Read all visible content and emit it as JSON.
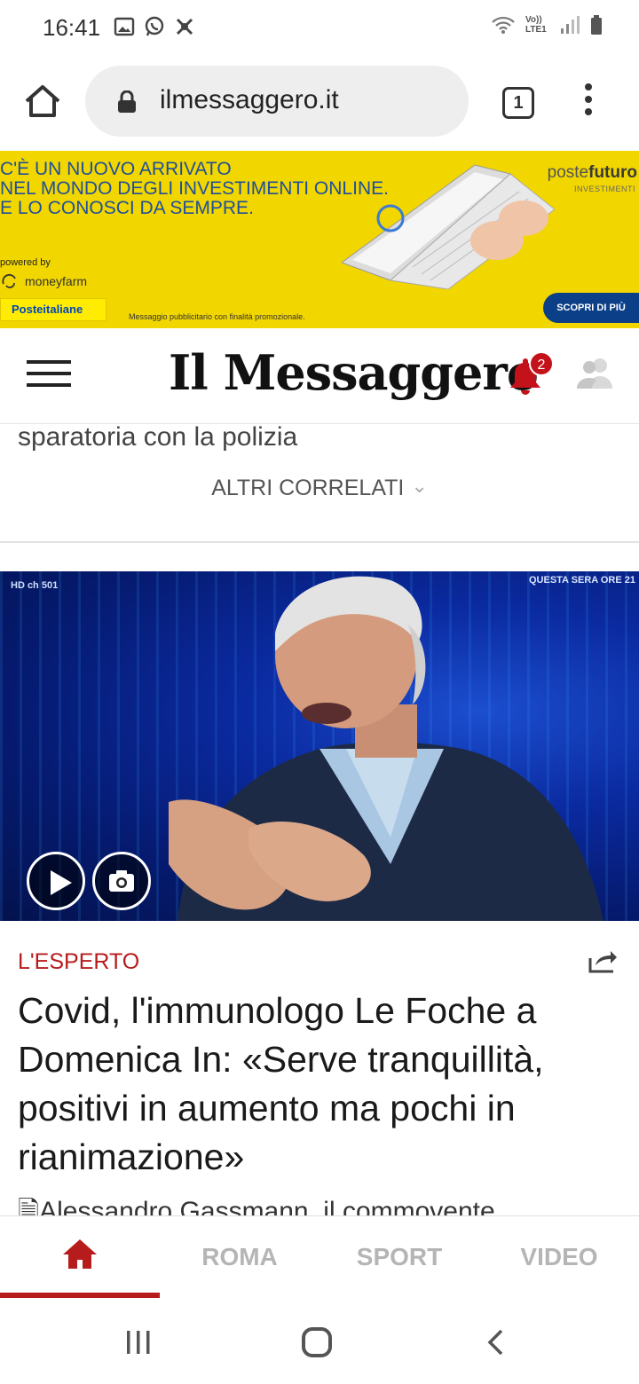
{
  "status_bar": {
    "time": "16:41",
    "icons_left": [
      "image-icon",
      "whatsapp-icon",
      "game-icon"
    ],
    "icons_right": [
      "wifi-icon",
      "volte-icon",
      "signal-icon",
      "battery-icon"
    ],
    "volte_label": "Vo)) LTE1"
  },
  "browser": {
    "url": "ilmessaggero.it",
    "tab_count": "1"
  },
  "ad": {
    "headline_lines": [
      "C'È UN NUOVO ARRIVATO",
      "NEL MONDO DEGLI INVESTIMENTI ONLINE.",
      "E LO CONOSCI DA SEMPRE."
    ],
    "powered_by": "powered by",
    "moneyfarm": "moneyfarm",
    "poste_label": "Posteitaliane",
    "disclaimer": "Messaggio pubblicitario con finalità promozionale.",
    "brand_left": "poste",
    "brand_right": "futuro",
    "brand_sub": "INVESTIMENTI",
    "cta": "SCOPRI DI PIÙ",
    "accent": "#f2d600"
  },
  "site": {
    "logo": "Il Messaggero",
    "notification_count": "2"
  },
  "correlated": {
    "prev_link": "sparatoria con la polizia",
    "altri": "ALTRI CORRELATI"
  },
  "video": {
    "hd_label": "HD ch 501",
    "overlay_text": "QUESTA SERA ORE 21"
  },
  "article": {
    "category": "L'ESPERTO",
    "title": "Covid, l'immunologo Le Foche a Domenica In: «Serve tranquillità, positivi in aumento ma pochi in rianimazione»",
    "related": "Alessandro Gassmann, il commovente"
  },
  "section_nav": {
    "items": [
      "ROMA",
      "SPORT",
      "VIDEO"
    ],
    "active_color": "#b71c1c"
  }
}
